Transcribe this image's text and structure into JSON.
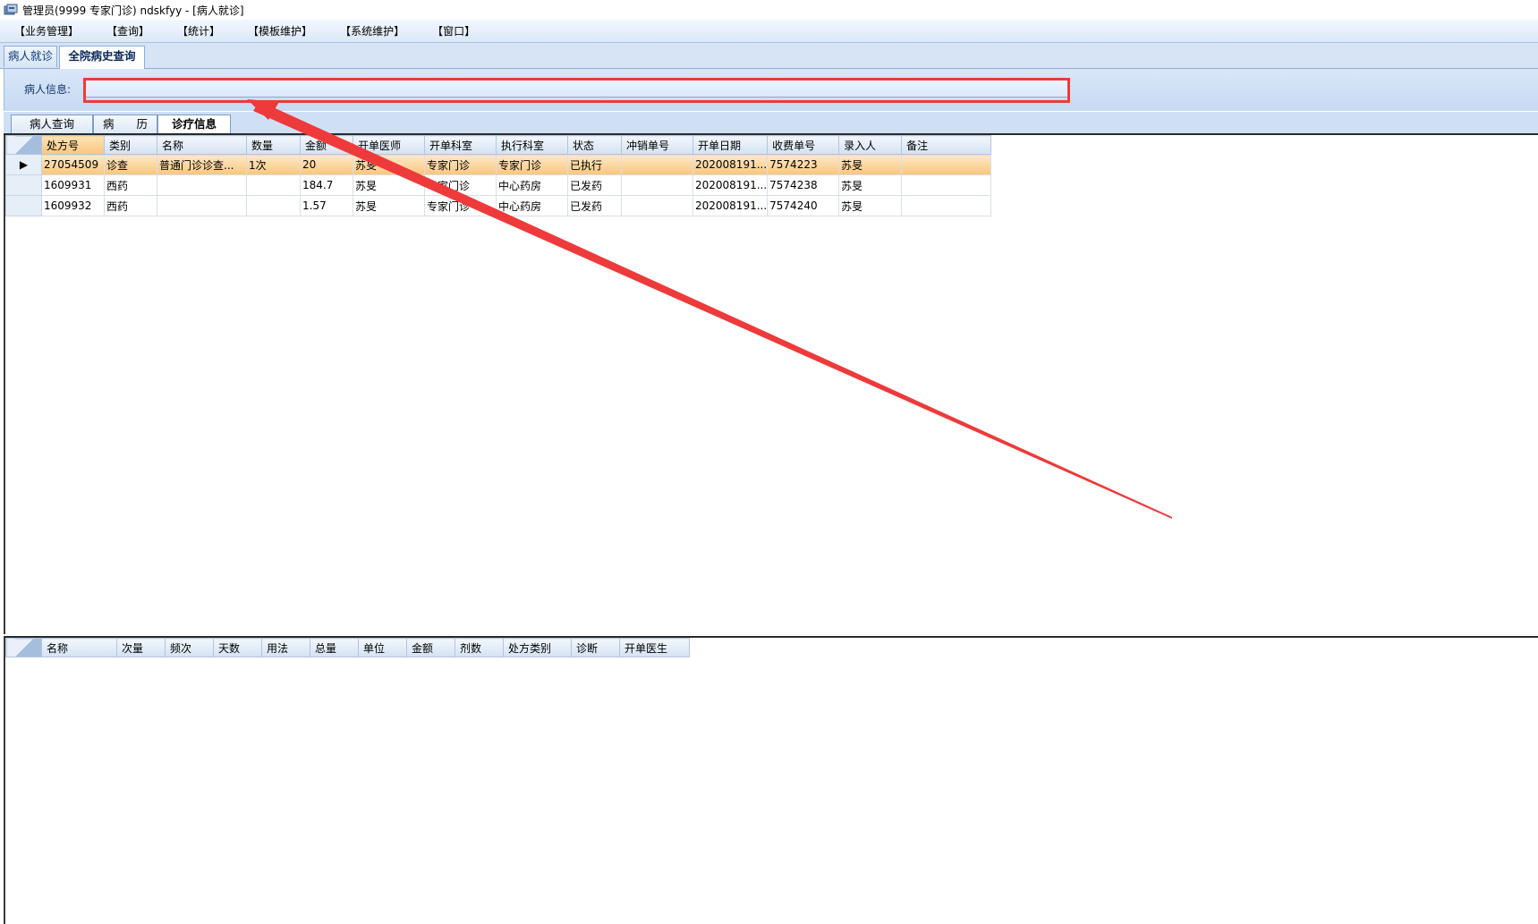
{
  "window": {
    "title": "管理员(9999 专家门诊) ndskfyy - [病人就诊]"
  },
  "menu": [
    "【业务管理】",
    "【查询】",
    "【统计】",
    "【模板维护】",
    "【系统维护】",
    "【窗口】"
  ],
  "doc_tabs": [
    "病人就诊",
    "全院病史查询"
  ],
  "patient_info": {
    "label": "病人信息:",
    "value": ""
  },
  "sub_tabs": [
    "病人查询",
    "病　　历",
    "诊疗信息"
  ],
  "top_grid": {
    "columns": [
      "处方号",
      "类别",
      "名称",
      "数量",
      "金额",
      "开单医师",
      "开单科室",
      "执行科室",
      "状态",
      "冲销单号",
      "开单日期",
      "收费单号",
      "录入人",
      "备注"
    ],
    "rows": [
      [
        "27054509",
        "诊查",
        "普通门诊诊查...",
        "1次",
        "20",
        "苏旻",
        "专家门诊",
        "专家门诊",
        "已执行",
        "",
        "202008191...",
        "7574223",
        "苏旻",
        ""
      ],
      [
        "1609931",
        "西药",
        "",
        "",
        "184.7",
        "苏旻",
        "专家门诊",
        "中心药房",
        "已发药",
        "",
        "202008191...",
        "7574238",
        "苏旻",
        ""
      ],
      [
        "1609932",
        "西药",
        "",
        "",
        "1.57",
        "苏旻",
        "专家门诊",
        "中心药房",
        "已发药",
        "",
        "202008191...",
        "7574240",
        "苏旻",
        ""
      ]
    ],
    "selected_row": 0,
    "row_indicator": "▶"
  },
  "bottom_grid": {
    "columns": [
      "名称",
      "次量",
      "频次",
      "天数",
      "用法",
      "总量",
      "单位",
      "金额",
      "剂数",
      "处方类别",
      "诊断",
      "开单医生"
    ]
  },
  "annotation": {
    "color": "#ee3a3a"
  }
}
